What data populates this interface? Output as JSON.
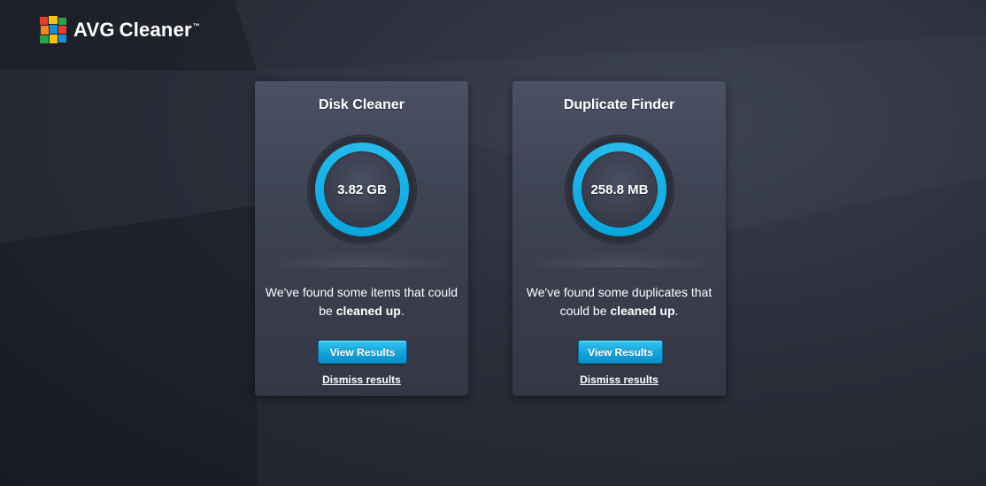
{
  "app": {
    "logo_brand": "AVG",
    "logo_product": "Cleaner",
    "logo_tm": "™"
  },
  "cards": [
    {
      "title": "Disk Cleaner",
      "value": "3.82 GB",
      "message_pre": "We've found some items that could be ",
      "message_bold": "cleaned up",
      "message_post": ".",
      "button_label": "View Results",
      "dismiss_label": "Dismiss results"
    },
    {
      "title": "Duplicate Finder",
      "value": "258.8 MB",
      "message_pre": "We've found some duplicates that could be ",
      "message_bold": "cleaned up",
      "message_post": ".",
      "button_label": "View Results",
      "dismiss_label": "Dismiss results"
    }
  ],
  "colors": {
    "accent": "#18b4e8",
    "button": "#16a6dc",
    "background": "#262a36",
    "card": "#3f4455"
  },
  "icons": {
    "logo": "avg-logo-icon"
  }
}
